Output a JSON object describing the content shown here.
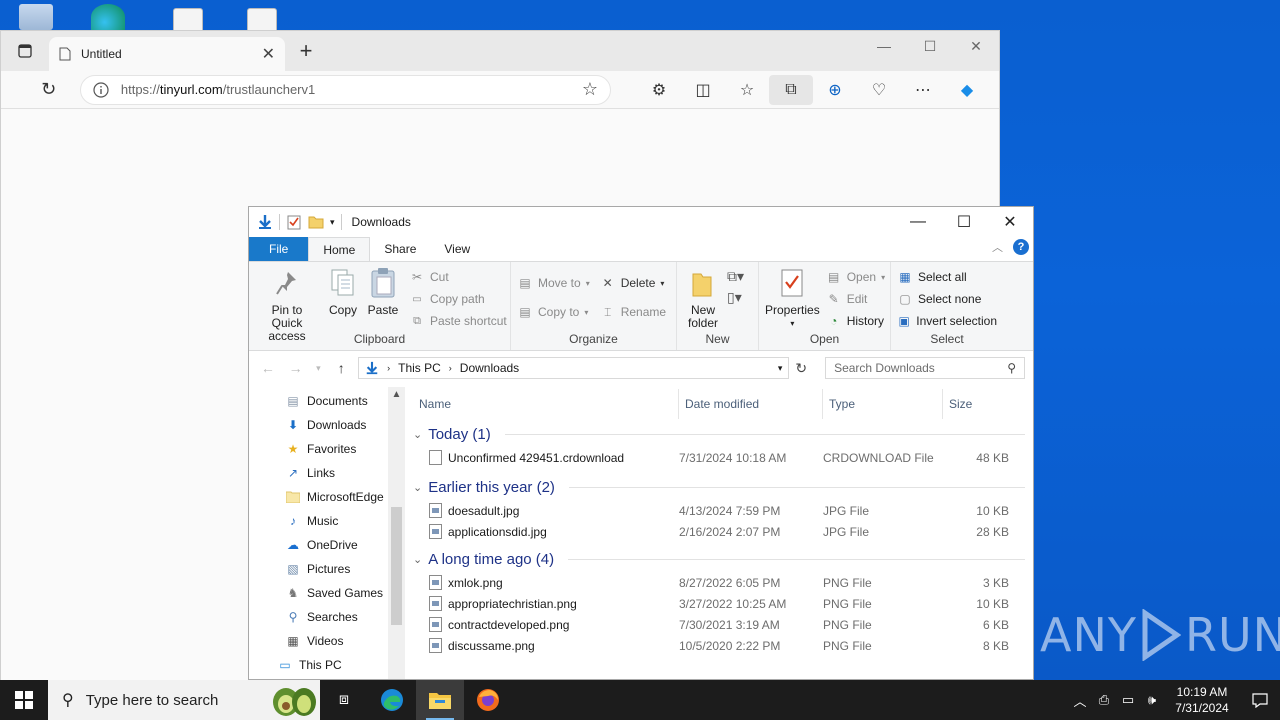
{
  "browser": {
    "tab_title": "Untitled",
    "url_host": "tinyurl.com",
    "url_prefix": "https://",
    "url_path": "/trustlauncherv1"
  },
  "explorer": {
    "title": "Downloads",
    "ribbon_tabs": [
      "File",
      "Home",
      "Share",
      "View"
    ],
    "clipboard": {
      "pin_label": "Pin to Quick access",
      "copy_label": "Copy",
      "paste_label": "Paste",
      "cut_label": "Cut",
      "copy_path_label": "Copy path",
      "paste_shortcut_label": "Paste shortcut",
      "group_label": "Clipboard"
    },
    "organize": {
      "move_to_label": "Move to",
      "copy_to_label": "Copy to",
      "delete_label": "Delete",
      "rename_label": "Rename",
      "group_label": "Organize"
    },
    "new": {
      "new_folder_label": "New folder",
      "group_label": "New"
    },
    "open": {
      "properties_label": "Properties",
      "open_label": "Open",
      "edit_label": "Edit",
      "history_label": "History",
      "group_label": "Open"
    },
    "select": {
      "select_all_label": "Select all",
      "select_none_label": "Select none",
      "invert_label": "Invert selection",
      "group_label": "Select"
    },
    "path": [
      "This PC",
      "Downloads"
    ],
    "search_placeholder": "Search Downloads",
    "nav_items": [
      "Documents",
      "Downloads",
      "Favorites",
      "Links",
      "MicrosoftEdge",
      "Music",
      "OneDrive",
      "Pictures",
      "Saved Games",
      "Searches",
      "Videos",
      "This PC"
    ],
    "columns": [
      "Name",
      "Date modified",
      "Type",
      "Size"
    ],
    "groups": [
      {
        "label": "Today (1)",
        "files": [
          {
            "name": "Unconfirmed 429451.crdownload",
            "date": "7/31/2024 10:18 AM",
            "type": "CRDOWNLOAD File",
            "size": "48 KB",
            "icon": "blank-file-icon"
          }
        ]
      },
      {
        "label": "Earlier this year (2)",
        "files": [
          {
            "name": "doesadult.jpg",
            "date": "4/13/2024 7:59 PM",
            "type": "JPG File",
            "size": "10 KB",
            "icon": "image-file-icon"
          },
          {
            "name": "applicationsdid.jpg",
            "date": "2/16/2024 2:07 PM",
            "type": "JPG File",
            "size": "28 KB",
            "icon": "image-file-icon"
          }
        ]
      },
      {
        "label": "A long time ago (4)",
        "files": [
          {
            "name": "xmlok.png",
            "date": "8/27/2022 6:05 PM",
            "type": "PNG File",
            "size": "3 KB",
            "icon": "image-file-icon"
          },
          {
            "name": "appropriatechristian.png",
            "date": "3/27/2022 10:25 AM",
            "type": "PNG File",
            "size": "10 KB",
            "icon": "image-file-icon"
          },
          {
            "name": "contractdeveloped.png",
            "date": "7/30/2021 3:19 AM",
            "type": "PNG File",
            "size": "6 KB",
            "icon": "image-file-icon"
          },
          {
            "name": "discussame.png",
            "date": "10/5/2020 2:22 PM",
            "type": "PNG File",
            "size": "8 KB",
            "icon": "image-file-icon"
          }
        ]
      }
    ]
  },
  "taskbar": {
    "search_placeholder": "Type here to search",
    "time": "10:19 AM",
    "date": "7/31/2024"
  },
  "watermark": {
    "text_left": "ANY",
    "text_right": "RUN"
  },
  "colors": {
    "desktop": "#0a5fd0",
    "file_tab": "#1979ca",
    "group_header": "#1e3287",
    "taskbar": "#1c1c1c"
  }
}
